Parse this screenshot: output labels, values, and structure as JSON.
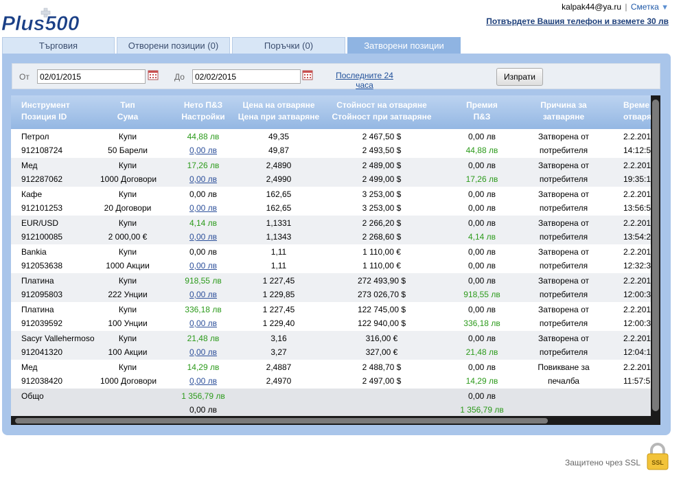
{
  "brand": {
    "logo_text": "Plus500"
  },
  "header": {
    "user_email": "kalpak44@ya.ru",
    "separator": "|",
    "account_label": "Сметка",
    "confirm_phone": "Потвърдете Вашия телефон и вземете 30 лв"
  },
  "tabs": [
    {
      "label": "Търговия"
    },
    {
      "label": "Отворени позиции (0)"
    },
    {
      "label": "Поръчки (0)"
    },
    {
      "label": "Затворени позиции"
    }
  ],
  "filter": {
    "from_label": "От",
    "from_value": "02/01/2015",
    "to_label": "До",
    "to_value": "02/02/2015",
    "last24_line1": "Последните 24",
    "last24_line2": "часа",
    "send_label": "Изпрати"
  },
  "columns": [
    {
      "line1": "Инструмент",
      "line2": "Позиция ID"
    },
    {
      "line1": "Тип",
      "line2": "Сума"
    },
    {
      "line1": "Нето П&З",
      "line2": "Настройки"
    },
    {
      "line1": "Цена на отваряне",
      "line2": "Цена при затваряне"
    },
    {
      "line1": "Стойност на отваряне",
      "line2": "Стойност при затваряне"
    },
    {
      "line1": "Премия",
      "line2": "П&З"
    },
    {
      "line1": "Причина за",
      "line2": "затваряне"
    },
    {
      "line1": "Време",
      "line2": "отваря"
    }
  ],
  "rows": [
    {
      "instrument": "Петрол",
      "id": "912108724",
      "type": "Купи",
      "amount": "50 Барели",
      "net_pnl": "44,88 лв",
      "net_green": true,
      "settings": "0,00 лв",
      "open_price": "49,35",
      "close_price": "49,87",
      "open_value": "2 467,50 $",
      "close_value": "2 493,50 $",
      "premium": "0,00 лв",
      "pnl": "44,88 лв",
      "reason1": "Затворена от",
      "reason2": "потребителя",
      "time1": "2.2.201",
      "time2": "14:12:5"
    },
    {
      "instrument": "Мед",
      "id": "912287062",
      "type": "Купи",
      "amount": "1000 Договори",
      "net_pnl": "17,26 лв",
      "net_green": true,
      "settings": "0,00 лв",
      "open_price": "2,4890",
      "close_price": "2,4990",
      "open_value": "2 489,00 $",
      "close_value": "2 499,00 $",
      "premium": "0,00 лв",
      "pnl": "17,26 лв",
      "reason1": "Затворена от",
      "reason2": "потребителя",
      "time1": "2.2.201",
      "time2": "19:35:1"
    },
    {
      "instrument": "Кафе",
      "id": "912101253",
      "type": "Купи",
      "amount": "20 Договори",
      "net_pnl": "0,00 лв",
      "net_green": false,
      "settings": "0,00 лв",
      "open_price": "162,65",
      "close_price": "162,65",
      "open_value": "3 253,00 $",
      "close_value": "3 253,00 $",
      "premium": "0,00 лв",
      "pnl": "0,00 лв",
      "reason1": "Затворена от",
      "reason2": "потребителя",
      "time1": "2.2.201",
      "time2": "13:56:5"
    },
    {
      "instrument": "EUR/USD",
      "id": "912100085",
      "type": "Купи",
      "amount": "2 000,00 €",
      "net_pnl": "4,14 лв",
      "net_green": true,
      "settings": "0,00 лв",
      "open_price": "1,1331",
      "close_price": "1,1343",
      "open_value": "2 266,20 $",
      "close_value": "2 268,60 $",
      "premium": "0,00 лв",
      "pnl": "4,14 лв",
      "reason1": "Затворена от",
      "reason2": "потребителя",
      "time1": "2.2.201",
      "time2": "13:54:2"
    },
    {
      "instrument": "Bankia",
      "id": "912053638",
      "type": "Купи",
      "amount": "1000 Акции",
      "net_pnl": "0,00 лв",
      "net_green": false,
      "settings": "0,00 лв",
      "open_price": "1,11",
      "close_price": "1,11",
      "open_value": "1 110,00 €",
      "close_value": "1 110,00 €",
      "premium": "0,00 лв",
      "pnl": "0,00 лв",
      "reason1": "Затворена от",
      "reason2": "потребителя",
      "time1": "2.2.201",
      "time2": "12:32:3"
    },
    {
      "instrument": "Платина",
      "id": "912095803",
      "type": "Купи",
      "amount": "222 Унции",
      "net_pnl": "918,55 лв",
      "net_green": true,
      "settings": "0,00 лв",
      "open_price": "1 227,45",
      "close_price": "1 229,85",
      "open_value": "272 493,90 $",
      "close_value": "273 026,70 $",
      "premium": "0,00 лв",
      "pnl": "918,55 лв",
      "reason1": "Затворена от",
      "reason2": "потребителя",
      "time1": "2.2.201",
      "time2": "12:00:3"
    },
    {
      "instrument": "Платина",
      "id": "912039592",
      "type": "Купи",
      "amount": "100 Унции",
      "net_pnl": "336,18 лв",
      "net_green": true,
      "settings": "0,00 лв",
      "open_price": "1 227,45",
      "close_price": "1 229,40",
      "open_value": "122 745,00 $",
      "close_value": "122 940,00 $",
      "premium": "0,00 лв",
      "pnl": "336,18 лв",
      "reason1": "Затворена от",
      "reason2": "потребителя",
      "time1": "2.2.201",
      "time2": "12:00:3"
    },
    {
      "instrument": "Sacyr Vallehermoso",
      "id": "912041320",
      "type": "Купи",
      "amount": "100 Акции",
      "net_pnl": "21,48 лв",
      "net_green": true,
      "settings": "0,00 лв",
      "open_price": "3,16",
      "close_price": "3,27",
      "open_value": "316,00 €",
      "close_value": "327,00 €",
      "premium": "0,00 лв",
      "pnl": "21,48 лв",
      "reason1": "Затворена от",
      "reason2": "потребителя",
      "time1": "2.2.201",
      "time2": "12:04:1"
    },
    {
      "instrument": "Мед",
      "id": "912038420",
      "type": "Купи",
      "amount": "1000 Договори",
      "net_pnl": "14,29 лв",
      "net_green": true,
      "settings": "0,00 лв",
      "open_price": "2,4887",
      "close_price": "2,4970",
      "open_value": "2 488,70 $",
      "close_value": "2 497,00 $",
      "premium": "0,00 лв",
      "pnl": "14,29 лв",
      "reason1": "Повикване за",
      "reason2": "печалба",
      "time1": "2.2.201",
      "time2": "11:57:5"
    }
  ],
  "totals": {
    "label": "Общо",
    "net_pnl": "1 356,79 лв",
    "settings": "0,00 лв",
    "premium": "0,00 лв",
    "pnl": "1 356,79 лв"
  },
  "footer": {
    "ssl_text": "Защитено чрез SSL",
    "ssl_badge": "SSL"
  },
  "colors": {
    "accent": "#1d3f7a",
    "panel": "#a9c5ea",
    "green": "#2b9a1a",
    "tab_active": "#8fb4e2"
  }
}
